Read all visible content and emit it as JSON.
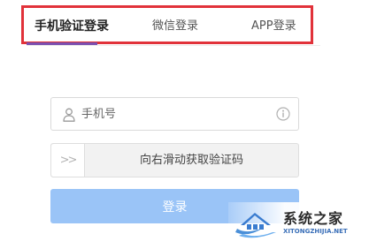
{
  "tabs": {
    "phone_login": "手机验证登录",
    "wechat_login": "微信登录",
    "app_login": "APP登录"
  },
  "form": {
    "phone_placeholder": "手机号",
    "slider_handle": ">>",
    "slider_text": "向右滑动获取验证码",
    "login_button": "登录"
  },
  "watermark": {
    "name": "系统之家",
    "url": "XITONGZHIJIA.NET"
  },
  "colors": {
    "highlight_border": "#e1323a",
    "active_tab_underline": "#7b4fb0",
    "login_button": "#9ac4f7"
  }
}
